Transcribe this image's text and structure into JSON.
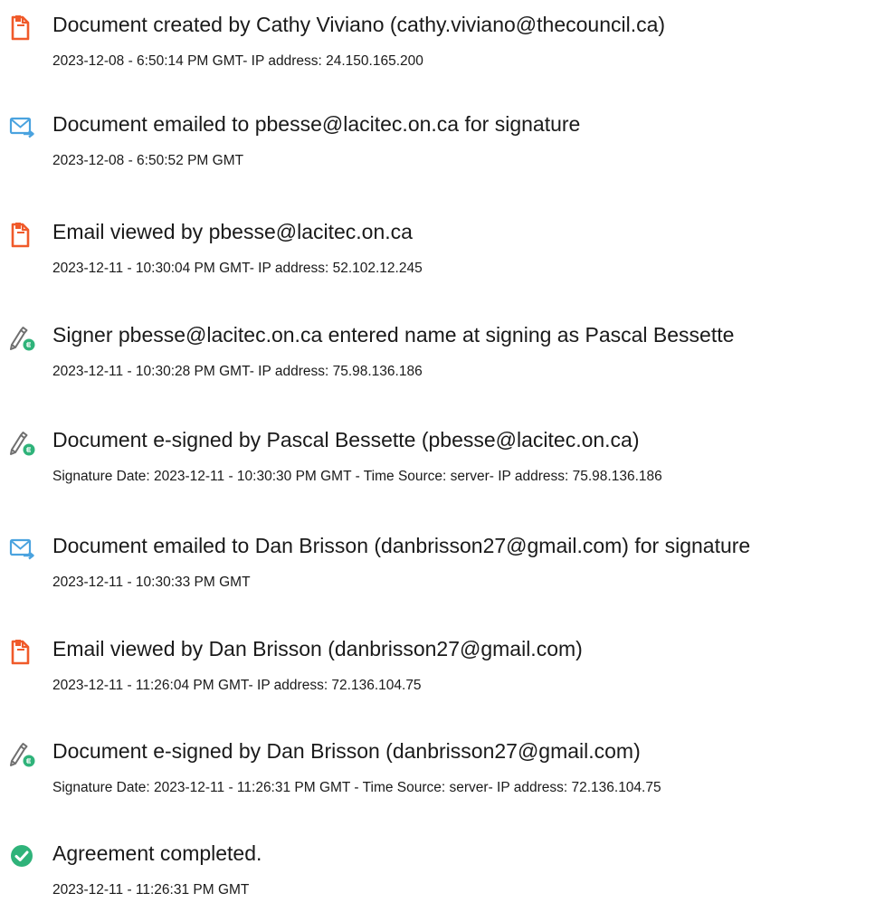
{
  "colors": {
    "document_icon": "#f05a2a",
    "email_icon": "#4aa3df",
    "esign_pen": "#6f6f6f",
    "esign_badge": "#2fb37a",
    "complete_icon": "#2fb37a",
    "text": "#1a1a1a"
  },
  "events": [
    {
      "icon": "document-icon",
      "title": "Document created by Cathy Viviano (cathy.viviano@thecouncil.ca)",
      "detail": "2023-12-08 - 6:50:14 PM GMT- IP address: 24.150.165.200"
    },
    {
      "icon": "email-sent-icon",
      "title": "Document emailed to pbesse@lacitec.on.ca for signature",
      "detail": "2023-12-08 - 6:50:52 PM GMT"
    },
    {
      "icon": "document-icon",
      "title": "Email viewed by pbesse@lacitec.on.ca",
      "detail": "2023-12-11 - 10:30:04 PM GMT- IP address: 52.102.12.245"
    },
    {
      "icon": "esign-icon",
      "title": "Signer pbesse@lacitec.on.ca entered name at signing as Pascal Bessette",
      "detail": "2023-12-11 - 10:30:28 PM GMT- IP address: 75.98.136.186"
    },
    {
      "icon": "esign-icon",
      "title": "Document e-signed by Pascal Bessette (pbesse@lacitec.on.ca)",
      "detail": "Signature Date: 2023-12-11 - 10:30:30 PM GMT - Time Source: server- IP address: 75.98.136.186"
    },
    {
      "icon": "email-sent-icon",
      "title": "Document emailed to Dan Brisson (danbrisson27@gmail.com) for signature",
      "detail": "2023-12-11 - 10:30:33 PM GMT"
    },
    {
      "icon": "document-icon",
      "title": "Email viewed by Dan Brisson (danbrisson27@gmail.com)",
      "detail": "2023-12-11 - 11:26:04 PM GMT- IP address: 72.136.104.75"
    },
    {
      "icon": "esign-icon",
      "title": "Document e-signed by Dan Brisson (danbrisson27@gmail.com)",
      "detail": "Signature Date: 2023-12-11 - 11:26:31 PM GMT - Time Source: server- IP address: 72.136.104.75"
    },
    {
      "icon": "checkmark-circle-icon",
      "title": "Agreement completed.",
      "detail": "2023-12-11 - 11:26:31 PM GMT"
    }
  ]
}
